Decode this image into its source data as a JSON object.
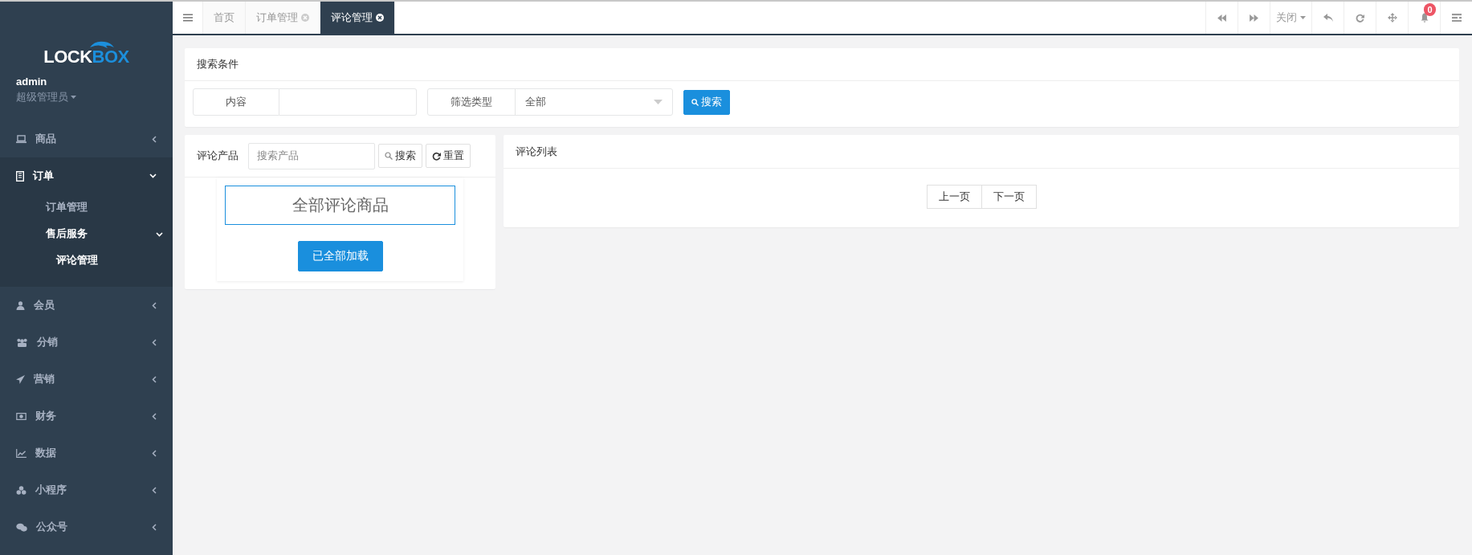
{
  "sidebar": {
    "logo": {
      "part_1": "LOCK",
      "part_2": "BOX"
    },
    "user": {
      "name": "admin",
      "role": "超级管理员"
    },
    "menu": [
      {
        "label": "商品",
        "expanded": false,
        "selected": false
      },
      {
        "label": "订单",
        "expanded": true,
        "children": [
          {
            "label": "订单管理",
            "selected": false
          },
          {
            "label": "售后服务",
            "expanded": true,
            "children": [
              {
                "label": "评论管理",
                "selected": true
              }
            ]
          }
        ]
      },
      {
        "label": "会员",
        "expanded": false,
        "selected": false
      },
      {
        "label": "分销",
        "expanded": false,
        "selected": false
      },
      {
        "label": "营销",
        "expanded": false,
        "selected": false
      },
      {
        "label": "财务",
        "expanded": false,
        "selected": false
      },
      {
        "label": "数据",
        "expanded": false,
        "selected": false
      },
      {
        "label": "小程序",
        "expanded": false,
        "selected": false
      },
      {
        "label": "公众号",
        "expanded": false,
        "selected": false
      }
    ]
  },
  "tabs": [
    {
      "label": "首页",
      "closable": false,
      "selected": false
    },
    {
      "label": "订单管理",
      "closable": true,
      "selected": false
    },
    {
      "label": "评论管理",
      "closable": true,
      "selected": true
    }
  ],
  "toolbar": {
    "close_menu": "关闭",
    "notification_count": "0"
  },
  "search_panel": {
    "title": "搜索条件",
    "content_field": {
      "label": "内容"
    },
    "type_select": {
      "label": "筛选类型",
      "value": "全部"
    },
    "search_button": "搜索"
  },
  "product_panel": {
    "title": "评论产品",
    "search": {
      "placeholder": "搜索产品"
    },
    "search_button": "搜索",
    "reset_button": "重置",
    "all_products": "全部评论商品",
    "load_button": "已全部加载"
  },
  "list_panel": {
    "title": "评论列表",
    "prev_button": "上一页",
    "next_button": "下一页"
  }
}
